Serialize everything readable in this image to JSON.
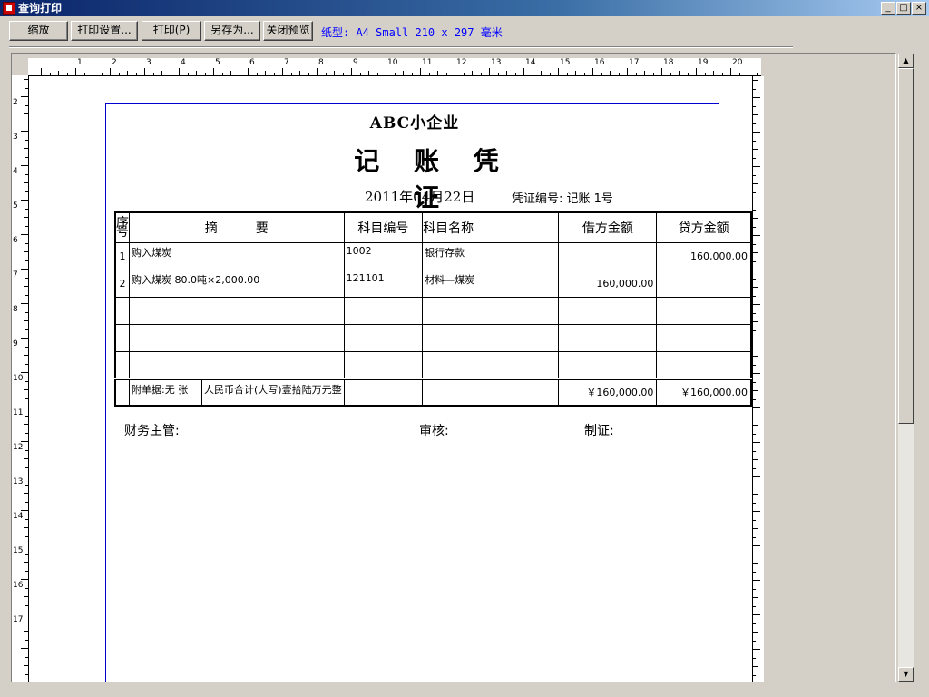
{
  "window": {
    "title": "查询打印"
  },
  "toolbar": {
    "zoom": "缩放",
    "print_setup": "打印设置...",
    "print": "打印(P)",
    "save_as": "另存为...",
    "close_preview": "关闭预览",
    "paper_info": "纸型: A4 Small 210 x 297 毫米"
  },
  "ruler": {
    "h_labels": [
      "1",
      "2",
      "3",
      "4",
      "5",
      "6",
      "7",
      "8",
      "9",
      "10",
      "11",
      "12",
      "13",
      "14",
      "15",
      "16",
      "17",
      "18",
      "19",
      "20"
    ],
    "v_labels": [
      "2",
      "3",
      "4",
      "5",
      "6",
      "7",
      "8",
      "9",
      "10",
      "11",
      "12",
      "13",
      "14",
      "15",
      "16",
      "17"
    ]
  },
  "voucher": {
    "company": "ABC小企业",
    "title": "记 账 凭 证",
    "date": "2011年04月22日",
    "voucher_no": "凭证编号: 记账 1号",
    "headers": {
      "seq": "序号",
      "summary": "摘　　　要",
      "account_code": "科目编号",
      "account_name": "科目名称",
      "debit": "借方金额",
      "credit": "贷方金额"
    },
    "rows": [
      {
        "seq": "1",
        "summary": "购入煤炭",
        "code": "1002",
        "name": "银行存款",
        "debit": "",
        "credit": "160,000.00"
      },
      {
        "seq": "2",
        "summary": "购入煤炭 80.0吨×2,000.00",
        "code": "121101",
        "name": "材料—煤炭",
        "debit": "160,000.00",
        "credit": ""
      },
      {
        "seq": "",
        "summary": "",
        "code": "",
        "name": "",
        "debit": "",
        "credit": ""
      },
      {
        "seq": "",
        "summary": "",
        "code": "",
        "name": "",
        "debit": "",
        "credit": ""
      },
      {
        "seq": "",
        "summary": "",
        "code": "",
        "name": "",
        "debit": "",
        "credit": ""
      }
    ],
    "total": {
      "attachments": "附单据:无 张",
      "amount_words": "人民币合计(大写)壹拾陆万元整",
      "debit_total": "￥160,000.00",
      "credit_total": "￥160,000.00"
    },
    "signatures": {
      "finance_manager": "财务主管:",
      "reviewer": "审核:",
      "preparer": "制证:"
    }
  }
}
